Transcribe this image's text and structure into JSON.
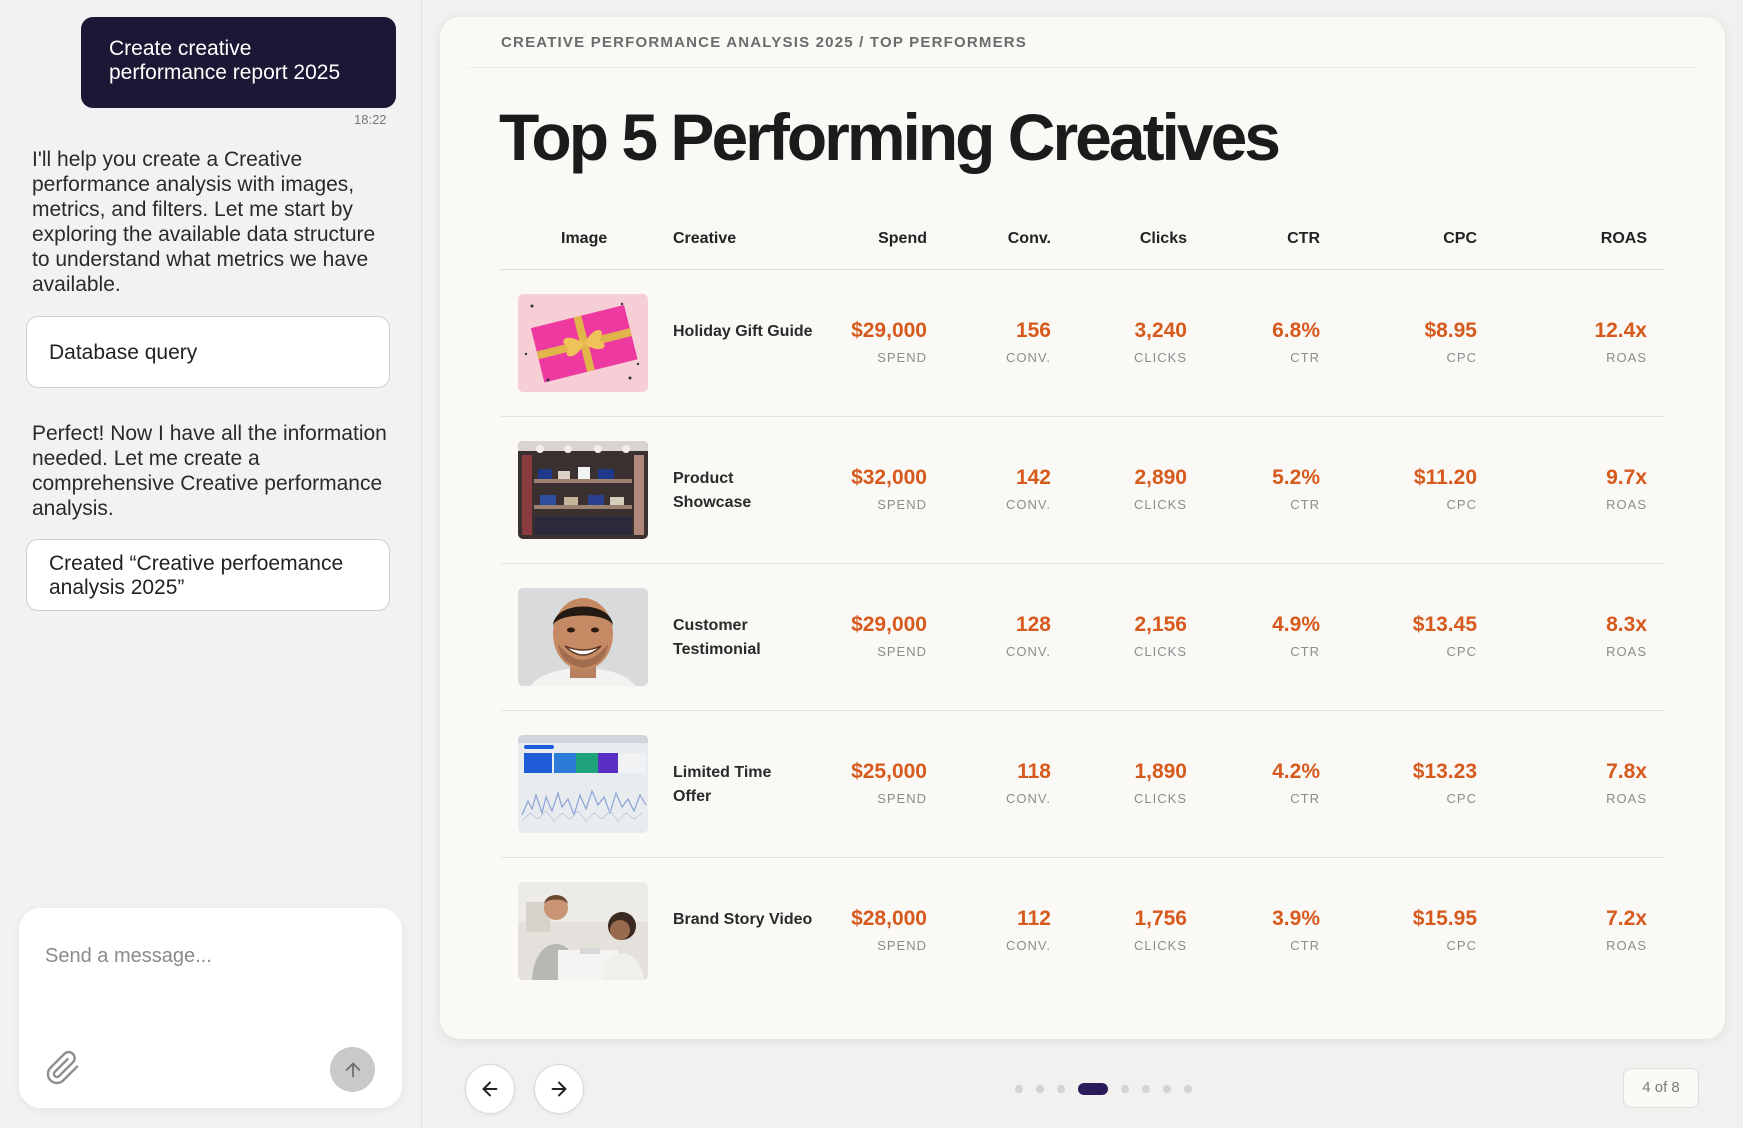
{
  "chat": {
    "user_message": "Create creative performance report 2025",
    "timestamp": "18:22",
    "assistant_intro": "I'll help you create a Creative performance  analysis with images, metrics, and filters. Let me start by exploring the available data structure to understand what metrics we have available.",
    "tool_query_label": "Database query",
    "assistant_followup": "Perfect! Now I have all the information needed. Let me create a comprehensive Creative performance analysis.",
    "tool_created_label": "Created “Creative perfoemance analysis 2025”",
    "composer_placeholder": "Send a message...",
    "attach_icon": "paperclip-icon",
    "send_icon": "arrow-up-icon"
  },
  "slide": {
    "breadcrumb": "CREATIVE PERFORMANCE ANALYSIS 2025 / TOP PERFORMERS",
    "title": "Top 5 Performing Creatives",
    "columns": {
      "image": "Image",
      "creative": "Creative",
      "spend": "Spend",
      "conv": "Conv.",
      "clicks": "Clicks",
      "ctr": "CTR",
      "cpc": "CPC",
      "roas": "ROAS"
    },
    "metric_labels": {
      "spend": "SPEND",
      "conv": "CONV.",
      "clicks": "CLICKS",
      "ctr": "CTR",
      "cpc": "CPC",
      "roas": "ROAS"
    },
    "rows": [
      {
        "creative": "Holiday Gift Guide",
        "thumbnail": "gift-box-image",
        "spend": "$29,000",
        "conv": "156",
        "clicks": "3,240",
        "ctr": "6.8%",
        "cpc": "$8.95",
        "roas": "12.4x"
      },
      {
        "creative": "Product Showcase",
        "thumbnail": "store-shelves-image",
        "spend": "$32,000",
        "conv": "142",
        "clicks": "2,890",
        "ctr": "5.2%",
        "cpc": "$11.20",
        "roas": "9.7x"
      },
      {
        "creative": "Customer Testimonial",
        "thumbnail": "smiling-man-image",
        "spend": "$29,000",
        "conv": "128",
        "clicks": "2,156",
        "ctr": "4.9%",
        "cpc": "$13.45",
        "roas": "8.3x"
      },
      {
        "creative": "Limited Time Offer",
        "thumbnail": "dashboard-screen-image",
        "spend": "$25,000",
        "conv": "118",
        "clicks": "1,890",
        "ctr": "4.2%",
        "cpc": "$13.23",
        "roas": "7.8x"
      },
      {
        "creative": "Brand Story Video",
        "thumbnail": "team-meeting-image",
        "spend": "$28,000",
        "conv": "112",
        "clicks": "1,756",
        "ctr": "3.9%",
        "cpc": "$15.95",
        "roas": "7.2x"
      }
    ]
  },
  "navigation": {
    "prev_icon": "arrow-left-icon",
    "next_icon": "arrow-right-icon",
    "total_slides": 8,
    "current_slide": 4,
    "page_indicator": "4 of 8"
  },
  "colors": {
    "accent_orange": "#d65a1d",
    "user_bubble": "#1e1635",
    "active_dot": "#2a1c5a"
  }
}
